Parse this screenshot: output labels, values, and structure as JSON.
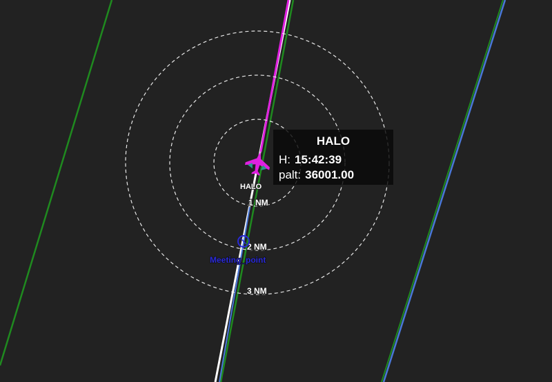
{
  "map": {
    "background": "#222222",
    "range_rings": [
      {
        "label": "1 NM"
      },
      {
        "label": "2 NM"
      },
      {
        "label": "3 NM"
      }
    ],
    "waypoint": {
      "label": "Meeting_point",
      "color": "#2a2ad8"
    },
    "aircraft": {
      "label": "HALO",
      "icon": "airplane-icon",
      "color": "#e020e0"
    },
    "tracks": {
      "route_color": "#e020e0",
      "flight_path_color": "#ffffff",
      "track_green_color": "#1f8a1f",
      "track_blue_color": "#4a78d8"
    }
  },
  "info_box": {
    "title": "HALO",
    "heading_label": "H:",
    "heading_value": "15:42:39",
    "palt_label": "palt:",
    "palt_value": "36001.00"
  }
}
